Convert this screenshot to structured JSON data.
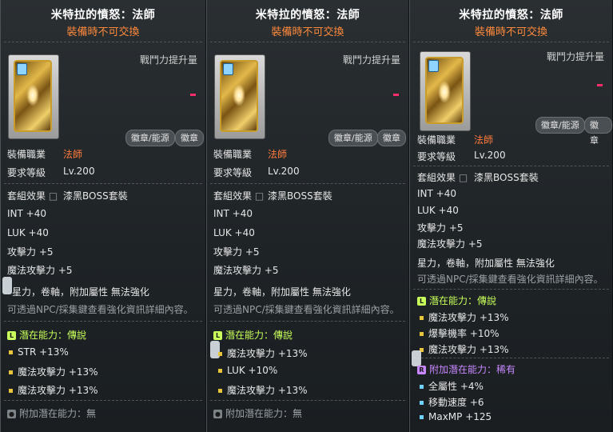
{
  "panels": [
    {
      "title": "米特拉的憤怒：法師",
      "trade_note": "裝備時不可交換",
      "power_label": "戰鬥力提升量",
      "tags": [
        "徽章/能源",
        "徽章"
      ],
      "job_label": "裝備職業",
      "job_value": "法師",
      "level_label": "要求等級",
      "level_value": "Lv.200",
      "set_label": "套組效果",
      "set_value": "漆黑BOSS套裝",
      "stats": [
        "INT  +40",
        "LUK  +40",
        "攻擊力  +5",
        "魔法攻擊力  +5"
      ],
      "enhance_text": "星力，卷軸，附加屬性  無法強化",
      "enhance_hint": "可透過NPC/採集鍵查看強化資訊詳細內容。",
      "potential_label": "潛在能力：傳說",
      "potential_lines": [
        "STR +13%",
        "魔法攻擊力 +13%",
        "魔法攻擊力 +13%"
      ],
      "bonus_label": "附加潛在能力：無"
    },
    {
      "title": "米特拉的憤怒：法師",
      "trade_note": "裝備時不可交換",
      "power_label": "戰鬥力提升量",
      "tags": [
        "徽章/能源",
        "徽章"
      ],
      "job_label": "裝備職業",
      "job_value": "法師",
      "level_label": "要求等級",
      "level_value": "Lv.200",
      "set_label": "套組效果",
      "set_value": "漆黑BOSS套裝",
      "stats": [
        "INT  +40",
        "LUK  +40",
        "攻擊力  +5",
        "魔法攻擊力  +5"
      ],
      "enhance_text": "星力，卷軸，附加屬性  無法強化",
      "enhance_hint": "可透過NPC/採集鍵查看強化資訊詳細內容。",
      "potential_label": "潛在能力：傳說",
      "potential_lines": [
        "魔法攻擊力 +13%",
        "LUK +10%",
        "魔法攻擊力 +13%"
      ],
      "bonus_label": "附加潛在能力：無"
    },
    {
      "title": "米特拉的憤怒：法師",
      "trade_note": "裝備時不可交換",
      "power_label": "戰鬥力提升量",
      "tags": [
        "徽章/能源",
        "徽章"
      ],
      "job_label": "裝備職業",
      "job_value": "法師",
      "level_label": "要求等級",
      "level_value": "Lv.200",
      "set_label": "套組效果",
      "set_value": "漆黑BOSS套裝",
      "stats": [
        "INT  +40",
        "LUK  +40",
        "攻擊力  +5",
        "魔法攻擊力  +5"
      ],
      "enhance_text": "星力，卷軸，附加屬性  無法強化",
      "enhance_hint": "可透過NPC/採集鍵查看強化資訊詳細內容。",
      "potential_label": "潛在能力：傳說",
      "potential_lines": [
        "魔法攻擊力 +13%",
        "爆擊機率 +10%",
        "魔法攻擊力 +13%"
      ],
      "bonus_label": "附加潛在能力：稀有",
      "bonus_lines": [
        "全屬性 +4%",
        "移動速度 +6",
        "MaxMP +125"
      ]
    }
  ],
  "colors": {
    "job": "#ff7a3a",
    "trade_note": "#ff8a3c",
    "potential": "#c8ff5a",
    "bonus_potential": "#c788ff"
  }
}
